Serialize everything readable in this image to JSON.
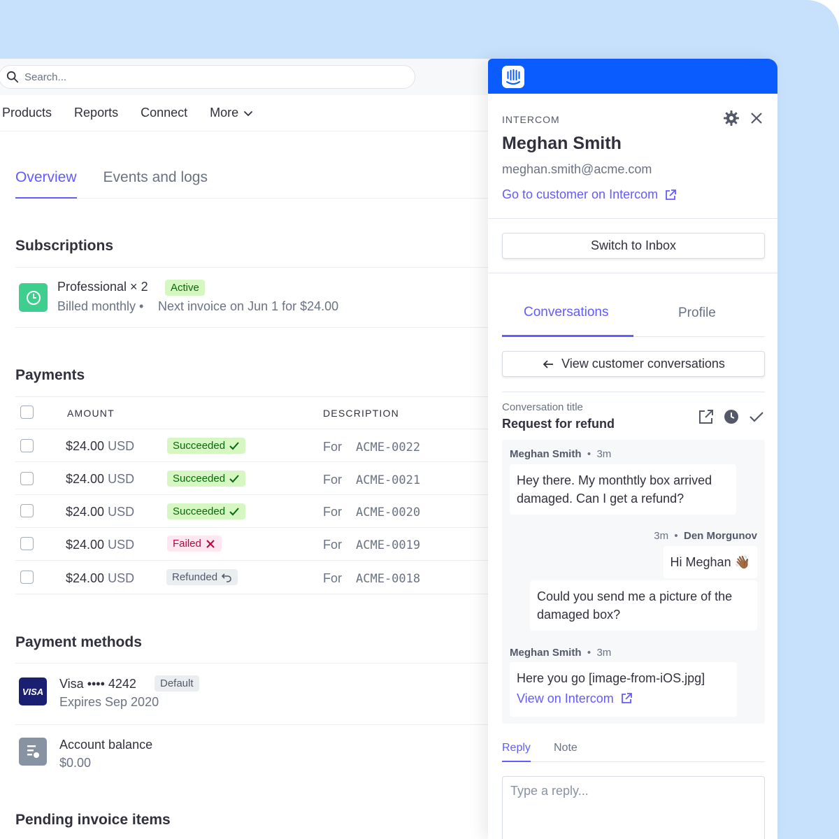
{
  "search": {
    "placeholder": "Search..."
  },
  "topnav": {
    "items": [
      "Products",
      "Reports",
      "Connect",
      "More"
    ]
  },
  "tabs": {
    "overview": "Overview",
    "events": "Events and logs"
  },
  "subscriptions": {
    "title": "Subscriptions",
    "plan": "Professional × 2",
    "status": "Active",
    "billing": "Billed monthly •",
    "next_invoice": "Next invoice on Jun 1 for $24.00"
  },
  "payments": {
    "title": "Payments",
    "columns": {
      "amount": "AMOUNT",
      "description": "DESCRIPTION"
    },
    "rows": [
      {
        "amount": "$24.00",
        "currency": "USD",
        "status": "Succeeded",
        "for": "For",
        "id": "ACME-0022"
      },
      {
        "amount": "$24.00",
        "currency": "USD",
        "status": "Succeeded",
        "for": "For",
        "id": "ACME-0021"
      },
      {
        "amount": "$24.00",
        "currency": "USD",
        "status": "Succeeded",
        "for": "For",
        "id": "ACME-0020"
      },
      {
        "amount": "$24.00",
        "currency": "USD",
        "status": "Failed",
        "for": "For",
        "id": "ACME-0019"
      },
      {
        "amount": "$24.00",
        "currency": "USD",
        "status": "Refunded",
        "for": "For",
        "id": "ACME-0018"
      }
    ]
  },
  "payment_methods": {
    "title": "Payment methods",
    "card_brand_logo": "VISA",
    "card": "Visa •••• 4242",
    "default": "Default",
    "expires": "Expires Sep 2020",
    "balance_label": "Account balance",
    "balance_value": "$0.00"
  },
  "pending": {
    "title": "Pending invoice items"
  },
  "intercom": {
    "label": "INTERCOM",
    "name": "Meghan Smith",
    "email": "meghan.smith@acme.com",
    "go_link": "Go to customer on Intercom",
    "switch_button": "Switch to Inbox",
    "tabs": {
      "conversations": "Conversations",
      "profile": "Profile"
    },
    "view_button": "View customer conversations",
    "conv_label": "Conversation title",
    "conv_title": "Request for refund",
    "messages": {
      "m1_author": "Meghan Smith",
      "m1_time": "3m",
      "m1_text": "Hey there. My monthtly box arrived damaged. Can I get a refund?",
      "m2_time": "3m",
      "m2_author": "Den Morgunov",
      "m2_text1": "Hi Meghan 👋🏾",
      "m2_text2": "Could you send me a picture of the damaged box?",
      "m3_author": "Meghan Smith",
      "m3_time": "3m",
      "m3_text": "Here you go [image-from-iOS.jpg]",
      "m3_link": "View on Intercom"
    },
    "reply_tabs": {
      "reply": "Reply",
      "note": "Note"
    },
    "reply_placeholder": "Type a reply..."
  },
  "colors": {
    "accent": "#635bff",
    "intercom_blue": "#0a5cff",
    "frame_bg": "#c7e0fb",
    "success": "#3ecf8e"
  }
}
